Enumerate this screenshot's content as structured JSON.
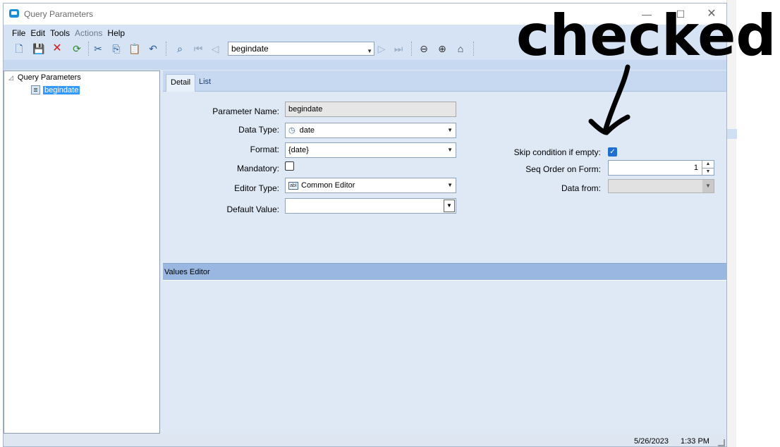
{
  "window": {
    "title": "Query Parameters",
    "controls": {
      "minimize": "—",
      "maximize": "☐",
      "close": "✕"
    }
  },
  "menu": {
    "items": [
      {
        "label": "File",
        "enabled": true
      },
      {
        "label": "Edit",
        "enabled": true
      },
      {
        "label": "Tools",
        "enabled": true
      },
      {
        "label": "Actions",
        "enabled": false
      },
      {
        "label": "Help",
        "enabled": true
      }
    ]
  },
  "toolbar": {
    "nav_value": "begindate"
  },
  "tree": {
    "root_label": "Query Parameters",
    "child_label": "begindate"
  },
  "tabs": {
    "detail": "Detail",
    "list": "List"
  },
  "form": {
    "param_name_label": "Parameter Name:",
    "param_name_value": "begindate",
    "data_type_label": "Data Type:",
    "data_type_value": "date",
    "format_label": "Format:",
    "format_value": "{date}",
    "mandatory_label": "Mandatory:",
    "mandatory_checked": false,
    "editor_type_label": "Editor Type:",
    "editor_type_value": "Common Editor",
    "editor_icon_text": "abI",
    "default_value_label": "Default Value:",
    "default_value": "",
    "skip_label": "Skip condition if empty:",
    "skip_checked": true,
    "seq_label": "Seq Order on Form:",
    "seq_value": "1",
    "data_from_label": "Data from:",
    "data_from_value": ""
  },
  "values_editor": {
    "title": "Values Editor"
  },
  "status": {
    "date": "5/26/2023",
    "time": "1:33 PM"
  },
  "annotation": {
    "text": "checked",
    "color": "#000000"
  },
  "colors": {
    "accent": "#3399ff",
    "checkbox_on": "#1f6fd1",
    "header_band": "#99b7e0"
  }
}
